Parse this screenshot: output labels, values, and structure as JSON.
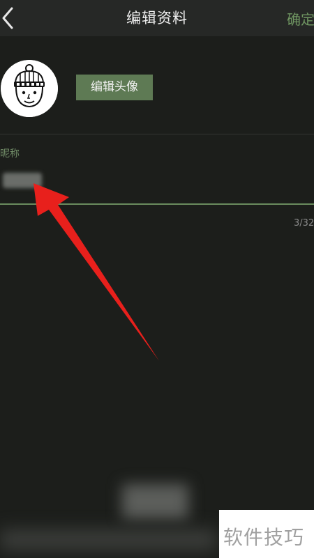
{
  "header": {
    "title": "编辑资料",
    "confirm_label": "确定"
  },
  "profile": {
    "edit_avatar_label": "编辑头像",
    "nickname_label": "昵称",
    "counter": "3/32"
  },
  "watermark": {
    "text": "软件技巧"
  },
  "colors": {
    "background": "#1c1e1b",
    "accent": "#5e7a54",
    "annotation_arrow": "#e8201c"
  },
  "icons": {
    "back": "chevron-left-icon",
    "avatar": "beanie-cartoon-avatar"
  }
}
